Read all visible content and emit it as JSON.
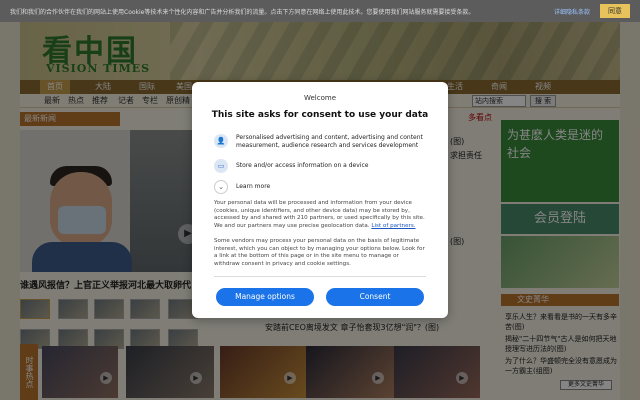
{
  "cookie_bar": {
    "text": "我们和我们的合作伙伴在我们的网站上使用Cookie等技术来个性化内容和广告并分析我们的流量。点击下方同意在网络上使用此技术。您要使用我们网站服务就需要接受条款。",
    "link": "详细隐私条款",
    "agree": "同意"
  },
  "header": {
    "logo": "看中国",
    "logo_sub": "VISION TIMES"
  },
  "nav": {
    "items": [
      "首页",
      "大陆",
      "国际",
      "美国",
      "",
      "",
      "",
      "",
      "",
      "生活",
      "奇闻",
      "视频"
    ]
  },
  "subnav": {
    "items": [
      "最新",
      "热点",
      "推荐",
      "记者",
      "专栏",
      "原创精"
    ]
  },
  "search": {
    "placeholder": "站内搜索",
    "button": "搜 索"
  },
  "left": {
    "section_title": "最新新闻",
    "hero_caption": "谁遇风报信？上官正义举报河北最大取卵代"
  },
  "middle": {
    "items": [
      "(图)",
      "求担责任",
      "(图)",
      "安踏前CEO离境发文 章子怡套现3亿想\"润\"？(图)"
    ],
    "top_right": "多看点"
  },
  "right": {
    "ad1": "为甚麽人类是迷的社会",
    "ad2": "会员登陆",
    "culture_title": "文史菁华",
    "culture_items": [
      "享乐人生？来看看是书的一天有多辛苦(图)",
      "揭秘\"二十四节气\"古人是如何把天地授理写进历法的(图)",
      "为了什么？华盛顿完全没有意愿成为一方霸主(组图)"
    ],
    "more": "更多文史菁华"
  },
  "bottom": {
    "title": "时事热点"
  },
  "dialog": {
    "welcome": "Welcome",
    "title": "This site asks for consent to use your data",
    "row1": "Personalised advertising and content, advertising and content measurement, audience research and services development",
    "row2": "Store and/or access information on a device",
    "row3": "Learn more",
    "para1": "Your personal data will be processed and information from your device (cookies, unique identifiers, and other device data) may be stored by, accessed by and shared with 210 partners, or used specifically by this site. We and our partners may use precise geolocation data.",
    "para1_link": "List of partners.",
    "para2": "Some vendors may process your personal data on the basis of legitimate interest, which you can object to by managing your options below. Look for a link at the bottom of this page or in the site menu to manage or withdraw consent in privacy and cookie settings.",
    "manage": "Manage options",
    "consent": "Consent"
  }
}
